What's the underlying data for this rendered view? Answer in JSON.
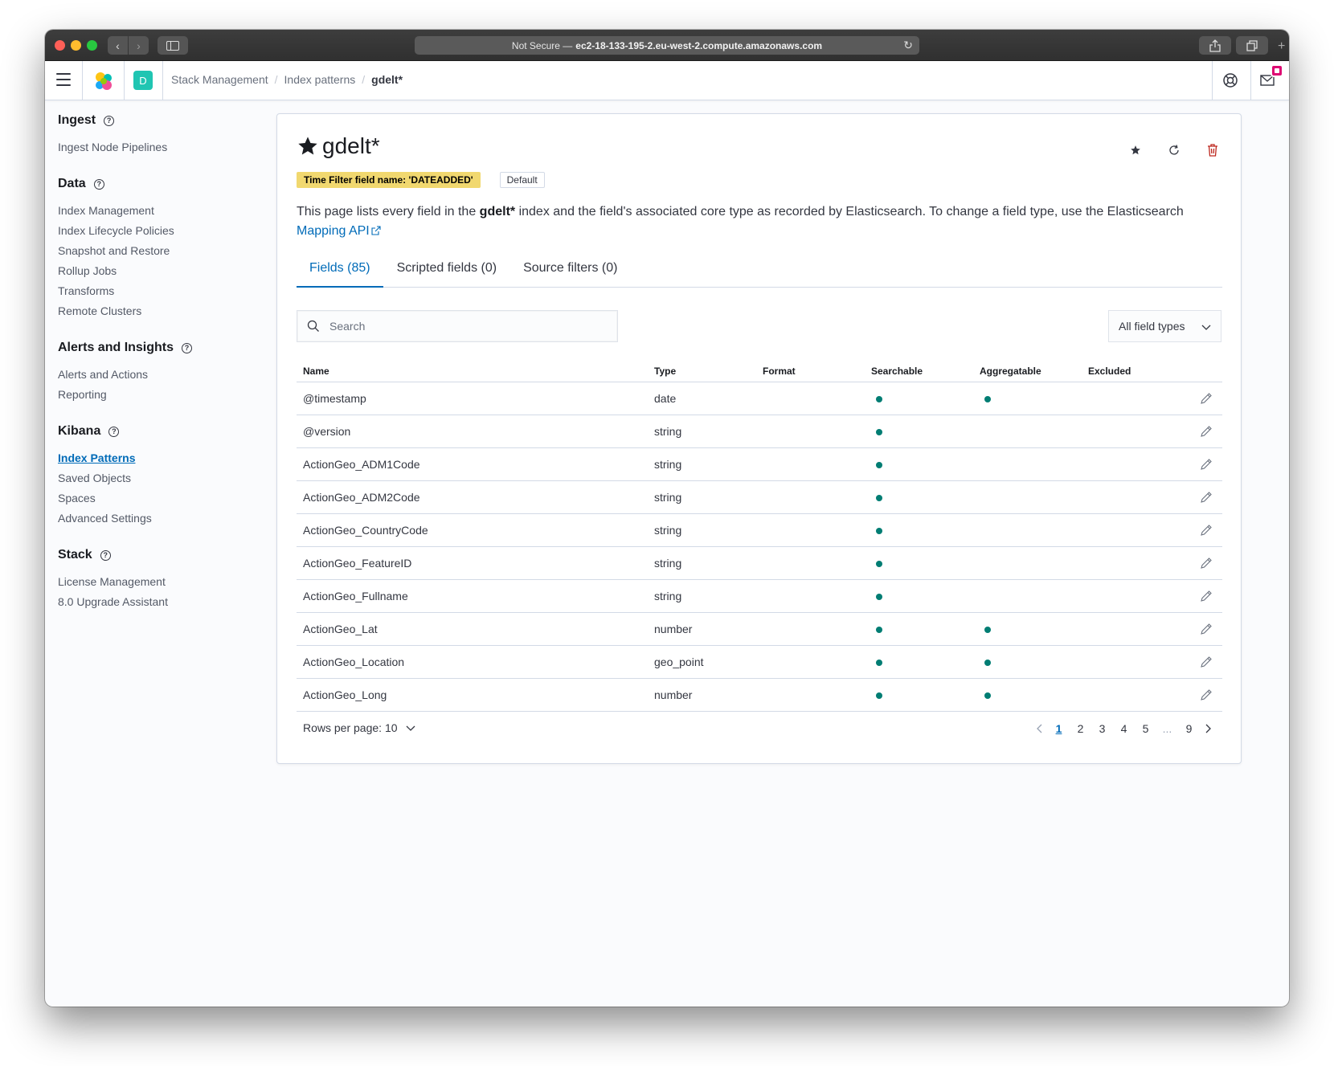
{
  "browser": {
    "address_prefix": "Not Secure —",
    "address_host": "ec2-18-133-195-2.eu-west-2.compute.amazonaws.com"
  },
  "header": {
    "space_initial": "D",
    "breadcrumbs": [
      "Stack Management",
      "Index patterns",
      "gdelt*"
    ]
  },
  "sidebar": {
    "sections": [
      {
        "title": "Ingest",
        "items": [
          "Ingest Node Pipelines"
        ]
      },
      {
        "title": "Data",
        "items": [
          "Index Management",
          "Index Lifecycle Policies",
          "Snapshot and Restore",
          "Rollup Jobs",
          "Transforms",
          "Remote Clusters"
        ]
      },
      {
        "title": "Alerts and Insights",
        "items": [
          "Alerts and Actions",
          "Reporting"
        ]
      },
      {
        "title": "Kibana",
        "items": [
          "Index Patterns",
          "Saved Objects",
          "Spaces",
          "Advanced Settings"
        ],
        "active": "Index Patterns"
      },
      {
        "title": "Stack",
        "items": [
          "License Management",
          "8.0 Upgrade Assistant"
        ]
      }
    ]
  },
  "main": {
    "title": "gdelt*",
    "time_filter_badge": "Time Filter field name: 'DATEADDED'",
    "default_badge": "Default",
    "description": {
      "part1": "This page lists every field in the ",
      "index": "gdelt*",
      "part2": " index and the field's associated core type as recorded by Elasticsearch. To change a field type, use the Elasticsearch ",
      "link": "Mapping API"
    },
    "tabs": [
      "Fields (85)",
      "Scripted fields (0)",
      "Source filters (0)"
    ],
    "search_placeholder": "Search",
    "type_filter": "All field types",
    "columns": [
      "Name",
      "Type",
      "Format",
      "Searchable",
      "Aggregatable",
      "Excluded"
    ],
    "rows": [
      {
        "name": "@timestamp",
        "type": "date",
        "searchable": true,
        "aggregatable": true
      },
      {
        "name": "@version",
        "type": "string",
        "searchable": true,
        "aggregatable": false
      },
      {
        "name": "ActionGeo_ADM1Code",
        "type": "string",
        "searchable": true,
        "aggregatable": false
      },
      {
        "name": "ActionGeo_ADM2Code",
        "type": "string",
        "searchable": true,
        "aggregatable": false
      },
      {
        "name": "ActionGeo_CountryCode",
        "type": "string",
        "searchable": true,
        "aggregatable": false
      },
      {
        "name": "ActionGeo_FeatureID",
        "type": "string",
        "searchable": true,
        "aggregatable": false
      },
      {
        "name": "ActionGeo_Fullname",
        "type": "string",
        "searchable": true,
        "aggregatable": false
      },
      {
        "name": "ActionGeo_Lat",
        "type": "number",
        "searchable": true,
        "aggregatable": true
      },
      {
        "name": "ActionGeo_Location",
        "type": "geo_point",
        "searchable": true,
        "aggregatable": true
      },
      {
        "name": "ActionGeo_Long",
        "type": "number",
        "searchable": true,
        "aggregatable": true
      }
    ],
    "rows_per_page": "Rows per page: 10",
    "pages": [
      "1",
      "2",
      "3",
      "4",
      "5",
      "...",
      "9"
    ],
    "current_page": "1"
  }
}
